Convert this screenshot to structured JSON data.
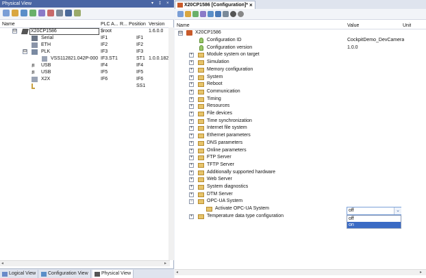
{
  "left_panel": {
    "title": "Physical View",
    "title_controls": [
      "▾",
      "‡",
      "×"
    ],
    "columns": [
      "Name",
      "PLC A...",
      "R...",
      "Position",
      "Version"
    ],
    "rows": [
      {
        "name": "X20CP1586",
        "addr": "$root",
        "pos": "",
        "version": "1.6.0.0",
        "expander": "⊟",
        "level": 0,
        "icon": "plc-icon"
      },
      {
        "name": "Serial",
        "addr": "IF1",
        "pos": "IF1",
        "version": "",
        "expander": "",
        "level": 1,
        "icon": "serial-icon"
      },
      {
        "name": "ETH",
        "addr": "IF2",
        "pos": "IF2",
        "version": "",
        "expander": "",
        "level": 1,
        "icon": "eth-icon"
      },
      {
        "name": "PLK",
        "addr": "IF3",
        "pos": "IF3",
        "version": "",
        "expander": "⊟",
        "level": 1,
        "icon": "plk-icon"
      },
      {
        "name": "VSS112821.042P-000",
        "addr": "IF3.ST1",
        "pos": "ST1",
        "version": "1.0.0.182",
        "expander": "",
        "level": 2,
        "icon": "device-icon"
      },
      {
        "name": "USB",
        "addr": "IF4",
        "pos": "IF4",
        "version": "",
        "expander": "",
        "level": 1,
        "icon": "usb-icon"
      },
      {
        "name": "USB",
        "addr": "IF5",
        "pos": "IF5",
        "version": "",
        "expander": "",
        "level": 1,
        "icon": "usb-icon"
      },
      {
        "name": "X2X",
        "addr": "IF6",
        "pos": "IF6",
        "version": "",
        "expander": "",
        "level": 1,
        "icon": "x2x-icon"
      },
      {
        "name": "",
        "addr": "",
        "pos": "SS1",
        "version": "",
        "expander": "",
        "level": 1,
        "icon": "slot-icon"
      }
    ]
  },
  "bottom_tabs": [
    {
      "label": "Logical View",
      "active": false
    },
    {
      "label": "Configuration View",
      "active": false
    },
    {
      "label": "Physical View",
      "active": true
    }
  ],
  "right_panel": {
    "tab_label": "X20CP1586 [Configuration]*",
    "tab_close": "×",
    "columns": [
      "Name",
      "Value",
      "Unit"
    ],
    "root": {
      "name": "X20CP1586",
      "expander": "⊟"
    },
    "items": [
      {
        "name": "Configuration ID",
        "value": "CockpitDemo_DevCamera",
        "kind": "leaf",
        "expander": ""
      },
      {
        "name": "Configuration version",
        "value": "1.0.0",
        "kind": "leaf",
        "expander": ""
      },
      {
        "name": "Module system on target",
        "value": "",
        "kind": "folder",
        "expander": "+"
      },
      {
        "name": "Simulation",
        "value": "",
        "kind": "folder",
        "expander": "+"
      },
      {
        "name": "Memory configuration",
        "value": "",
        "kind": "folder",
        "expander": "+"
      },
      {
        "name": "System",
        "value": "",
        "kind": "folder",
        "expander": "+"
      },
      {
        "name": "Reboot",
        "value": "",
        "kind": "folder",
        "expander": "+"
      },
      {
        "name": "Communication",
        "value": "",
        "kind": "folder",
        "expander": "+"
      },
      {
        "name": "Timing",
        "value": "",
        "kind": "folder",
        "expander": "+"
      },
      {
        "name": "Resources",
        "value": "",
        "kind": "folder",
        "expander": "+"
      },
      {
        "name": "File devices",
        "value": "",
        "kind": "folder",
        "expander": "+"
      },
      {
        "name": "Time synchronization",
        "value": "",
        "kind": "folder",
        "expander": "+"
      },
      {
        "name": "Internet file system",
        "value": "",
        "kind": "folder",
        "expander": "+"
      },
      {
        "name": "Ethernet parameters",
        "value": "",
        "kind": "folder",
        "expander": "+"
      },
      {
        "name": "DNS parameters",
        "value": "",
        "kind": "folder",
        "expander": "+"
      },
      {
        "name": "Online parameters",
        "value": "",
        "kind": "folder",
        "expander": "+"
      },
      {
        "name": "FTP Server",
        "value": "",
        "kind": "folder",
        "expander": "+"
      },
      {
        "name": "TFTP Server",
        "value": "",
        "kind": "folder",
        "expander": "+"
      },
      {
        "name": "Additionally supported hardware",
        "value": "",
        "kind": "folder",
        "expander": "+"
      },
      {
        "name": "Web Server",
        "value": "",
        "kind": "folder",
        "expander": "+"
      },
      {
        "name": "System diagnostics",
        "value": "",
        "kind": "folder",
        "expander": "+"
      },
      {
        "name": "DTM Server",
        "value": "",
        "kind": "folder",
        "expander": "+"
      },
      {
        "name": "OPC-UA System",
        "value": "",
        "kind": "folder",
        "expander": "−"
      },
      {
        "name": "Activate OPC-UA System",
        "value": "",
        "kind": "sub",
        "expander": ""
      },
      {
        "name": "Temperature data type configuration",
        "value": "",
        "kind": "folder",
        "expander": "+"
      }
    ],
    "dropdown": {
      "selected": "off",
      "arrow": "⌄",
      "options": [
        {
          "label": "off",
          "selected": false
        },
        {
          "label": "on",
          "selected": true
        }
      ]
    }
  },
  "colors": {
    "title_bar": "#4a66a4",
    "selection": "#3a6ac4",
    "folder": "#e6c36a"
  }
}
